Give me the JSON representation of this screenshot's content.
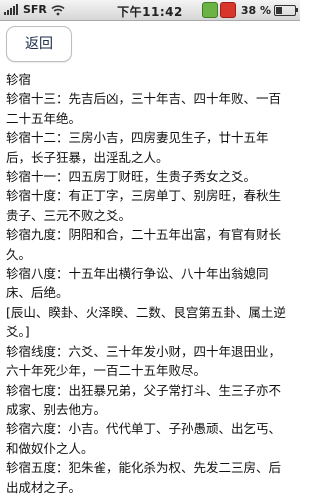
{
  "status_bar": {
    "carrier": "SFR",
    "time": "下午11:42",
    "battery_percent": "38 %",
    "battery_level": 0.38,
    "signal_bars": 5,
    "app_icons": [
      "green-app-icon",
      "red-app-icon"
    ],
    "url_hint": "www.88s1.com"
  },
  "nav": {
    "back_label": "返回"
  },
  "content": {
    "heading": "轸宿",
    "entries": [
      "轸宿十三：先吉后凶，三十年吉、四十年败、一百二十五年绝。",
      "轸宿十二：三房小吉，四房妻见生子，廿十五年后，长子狂暴，出淫乱之人。",
      "轸宿十一：四五房丁财旺，生贵子秀女之爻。",
      "轸宿十度：有正丁字，三房单丁、别房旺，春秋生贵子、三元不败之爻。",
      "轸宿九度：阴阳和合，二十五年出富，有官有财长久。",
      "轸宿八度：十五年出横行争讼、八十年出翁媳同床、后绝。",
      "[辰山、睽卦、火泽睽、二数、艮宫第五卦、属土逆爻。]",
      "轸宿线度：六爻、三十年发小财，四十年退田业，六十年死少年，一百二十五年败尽。",
      "轸宿七度：出狂暴兄弟，父子常打斗、生三子亦不成家、别去他方。",
      "轸宿六度：小吉。代代单丁、子孙愚顽、出乞丐、和做奴仆之人。",
      "轸宿五度：犯朱雀，能化杀为权、先发二三房、后出成材之子。"
    ]
  }
}
